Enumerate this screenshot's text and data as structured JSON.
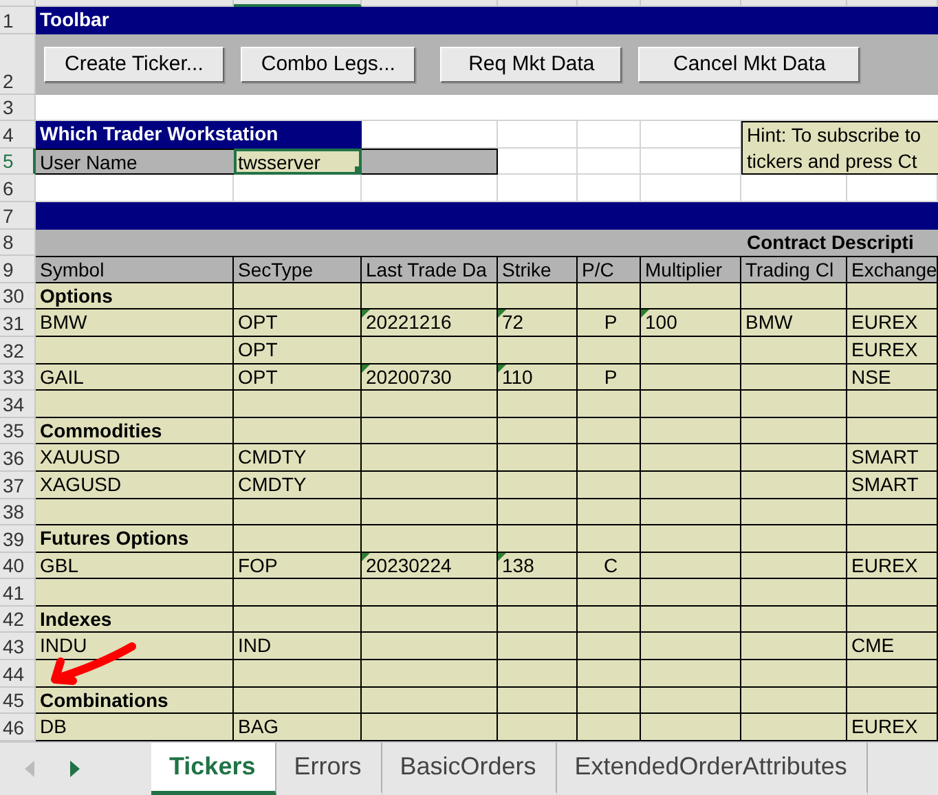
{
  "toolbar": {
    "title": "Toolbar",
    "buttons": [
      "Create Ticker...",
      "Combo Legs...",
      "Req Mkt Data",
      "Cancel Mkt Data"
    ]
  },
  "row_numbers": [
    "1",
    "2",
    "3",
    "4",
    "5",
    "6",
    "7",
    "8",
    "9"
  ],
  "workstation": {
    "title": "Which Trader Workstation",
    "label": "User Name",
    "value": "twsserver",
    "selected": true
  },
  "hint": [
    "Hint: To subscribe to",
    "tickers and press Ct"
  ],
  "section_title": "Contract Descripti",
  "columns": [
    "Symbol",
    "SecType",
    "Last Trade Da",
    "Strike",
    "P/C",
    "Multiplier",
    "Trading Cl",
    "Exchange"
  ],
  "rows": [
    {
      "number": "30",
      "kind": "section",
      "title": "Options"
    },
    {
      "number": "31",
      "kind": "data",
      "symbol": "BMW",
      "sec_type": "OPT",
      "last_trade_date": "20221216",
      "strike": "72",
      "p_c": "P",
      "multiplier": "100",
      "trading_class": "BMW",
      "exchange": "EUREX",
      "flagged": {
        "last_trade_date": true,
        "strike": true,
        "multiplier": true
      }
    },
    {
      "number": "32",
      "kind": "data",
      "sec_type": "OPT",
      "exchange": "EUREX"
    },
    {
      "number": "33",
      "kind": "data",
      "symbol": "GAIL",
      "sec_type": "OPT",
      "last_trade_date": "20200730",
      "strike": "110",
      "p_c": "P",
      "exchange": "NSE",
      "flagged": {
        "last_trade_date": true,
        "strike": true
      }
    },
    {
      "number": "34",
      "kind": "blank"
    },
    {
      "number": "35",
      "kind": "section",
      "title": "Commodities"
    },
    {
      "number": "36",
      "kind": "data",
      "symbol": "XAUUSD",
      "sec_type": "CMDTY",
      "exchange": "SMART"
    },
    {
      "number": "37",
      "kind": "data",
      "symbol": "XAGUSD",
      "sec_type": "CMDTY",
      "exchange": "SMART"
    },
    {
      "number": "38",
      "kind": "blank"
    },
    {
      "number": "39",
      "kind": "section",
      "title": "Futures Options"
    },
    {
      "number": "40",
      "kind": "data",
      "symbol": "GBL",
      "sec_type": "FOP",
      "last_trade_date": "20230224",
      "strike": "138",
      "p_c": "C",
      "exchange": "EUREX",
      "flagged": {
        "last_trade_date": true,
        "strike": true
      }
    },
    {
      "number": "41",
      "kind": "blank"
    },
    {
      "number": "42",
      "kind": "section",
      "title": "Indexes"
    },
    {
      "number": "43",
      "kind": "data",
      "symbol": "INDU",
      "sec_type": "IND",
      "exchange": "CME"
    },
    {
      "number": "44",
      "kind": "blank"
    },
    {
      "number": "45",
      "kind": "section",
      "title": "Combinations"
    },
    {
      "number": "46",
      "kind": "data",
      "symbol": "DB",
      "sec_type": "BAG",
      "exchange": "EUREX"
    }
  ],
  "sheet_tabs": [
    {
      "label": "Tickers",
      "selected": true
    },
    {
      "label": "Errors",
      "selected": false
    },
    {
      "label": "BasicOrders",
      "selected": false
    },
    {
      "label": "ExtendedOrderAttributes",
      "selected": false
    }
  ]
}
